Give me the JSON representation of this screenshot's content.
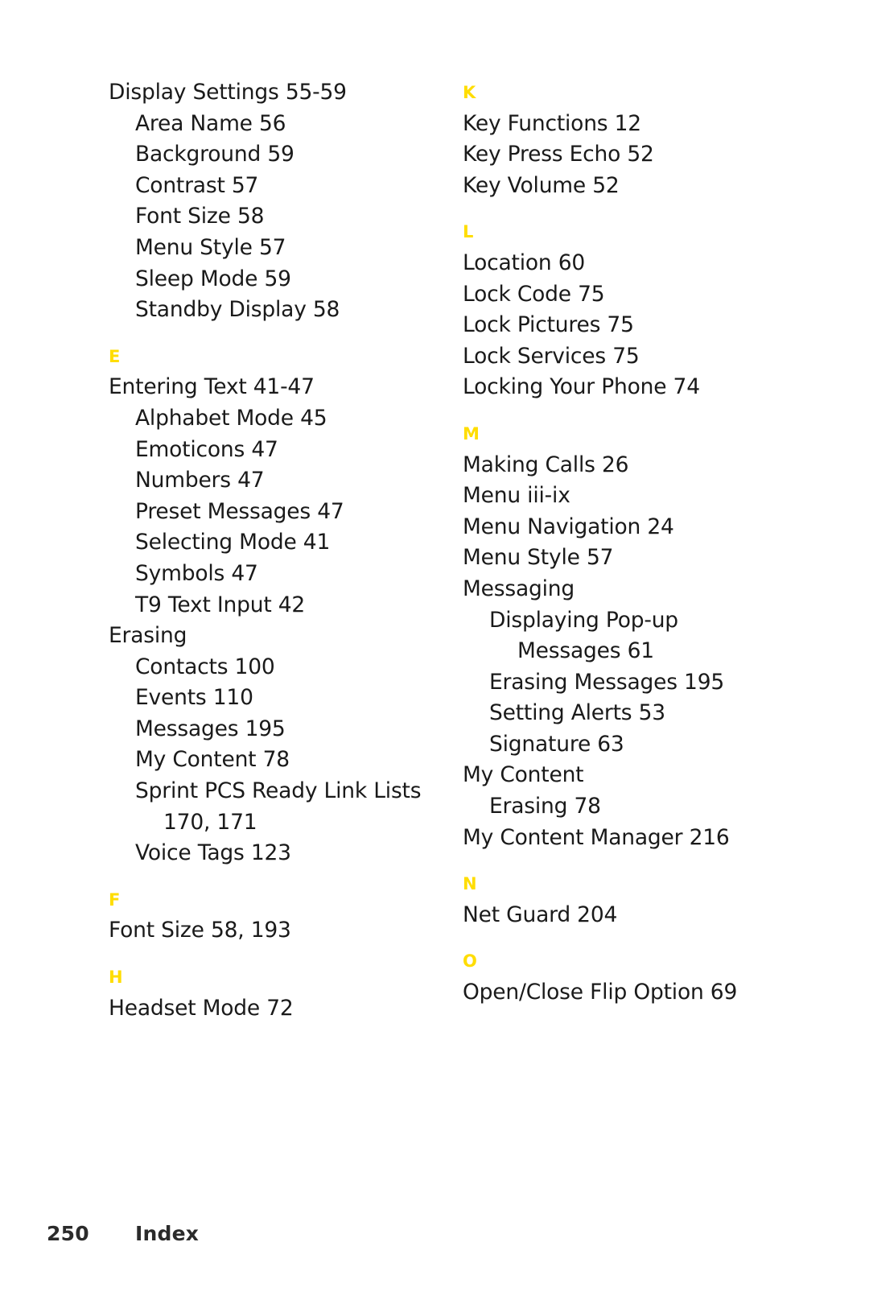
{
  "document": {
    "type": "index-page",
    "page_number": "250",
    "running_head": "Index",
    "accent_color": "#FFDD00",
    "text_color": "#1a1a1a",
    "background_color": "#ffffff"
  },
  "footer": {
    "page_number": "250",
    "label": "Index"
  },
  "columns": [
    {
      "id": "left",
      "blocks": [
        {
          "kind": "entries",
          "lines": [
            {
              "level": 0,
              "text": "Display Settings 55-59"
            },
            {
              "level": 1,
              "text": "Area Name 56"
            },
            {
              "level": 1,
              "text": "Background 59"
            },
            {
              "level": 1,
              "text": "Contrast 57"
            },
            {
              "level": 1,
              "text": "Font Size 58"
            },
            {
              "level": 1,
              "text": "Menu Style 57"
            },
            {
              "level": 1,
              "text": "Sleep Mode 59"
            },
            {
              "level": 1,
              "text": "Standby Display 58"
            }
          ]
        },
        {
          "kind": "section",
          "letter": "E",
          "lines": [
            {
              "level": 0,
              "text": "Entering Text 41-47"
            },
            {
              "level": 1,
              "text": "Alphabet Mode 45"
            },
            {
              "level": 1,
              "text": "Emoticons 47"
            },
            {
              "level": 1,
              "text": "Numbers 47"
            },
            {
              "level": 1,
              "text": "Preset Messages 47"
            },
            {
              "level": 1,
              "text": "Selecting Mode 41"
            },
            {
              "level": 1,
              "text": "Symbols 47"
            },
            {
              "level": 1,
              "text": "T9 Text Input 42"
            },
            {
              "level": 0,
              "text": "Erasing"
            },
            {
              "level": 1,
              "text": "Contacts 100"
            },
            {
              "level": 1,
              "text": "Events 110"
            },
            {
              "level": 1,
              "text": "Messages 195"
            },
            {
              "level": 1,
              "text": "My Content 78"
            },
            {
              "level": 1,
              "text": "Sprint PCS Ready Link Lists"
            },
            {
              "level": 1,
              "cont": 1,
              "text": "170, 171"
            },
            {
              "level": 1,
              "text": "Voice Tags 123"
            }
          ]
        },
        {
          "kind": "section",
          "letter": "F",
          "lines": [
            {
              "level": 0,
              "text": "Font Size 58, 193"
            }
          ]
        },
        {
          "kind": "section",
          "letter": "H",
          "lines": [
            {
              "level": 0,
              "text": "Headset Mode 72"
            }
          ]
        }
      ]
    },
    {
      "id": "right",
      "blocks": [
        {
          "kind": "section",
          "letter": "K",
          "first": true,
          "lines": [
            {
              "level": 0,
              "text": "Key Functions 12"
            },
            {
              "level": 0,
              "text": "Key Press Echo 52"
            },
            {
              "level": 0,
              "text": "Key Volume 52"
            }
          ]
        },
        {
          "kind": "section",
          "letter": "L",
          "lines": [
            {
              "level": 0,
              "text": "Location 60"
            },
            {
              "level": 0,
              "text": "Lock Code 75"
            },
            {
              "level": 0,
              "text": "Lock Pictures 75"
            },
            {
              "level": 0,
              "text": "Lock Services 75"
            },
            {
              "level": 0,
              "text": "Locking Your Phone 74"
            }
          ]
        },
        {
          "kind": "section",
          "letter": "M",
          "lines": [
            {
              "level": 0,
              "text": "Making Calls 26"
            },
            {
              "level": 0,
              "text": "Menu iii-ix"
            },
            {
              "level": 0,
              "text": "Menu Navigation 24"
            },
            {
              "level": 0,
              "text": "Menu Style 57"
            },
            {
              "level": 0,
              "text": "Messaging"
            },
            {
              "level": 1,
              "text": "Displaying Pop-up"
            },
            {
              "level": 1,
              "cont": 1,
              "text": "Messages 61"
            },
            {
              "level": 1,
              "text": "Erasing Messages 195"
            },
            {
              "level": 1,
              "text": "Setting Alerts 53"
            },
            {
              "level": 1,
              "text": "Signature 63"
            },
            {
              "level": 0,
              "text": "My Content"
            },
            {
              "level": 1,
              "text": "Erasing 78"
            },
            {
              "level": 0,
              "text": "My Content Manager 216"
            }
          ]
        },
        {
          "kind": "section",
          "letter": "N",
          "lines": [
            {
              "level": 0,
              "text": "Net Guard 204"
            }
          ]
        },
        {
          "kind": "section",
          "letter": "O",
          "lines": [
            {
              "level": 0,
              "text": "Open/Close Flip Option 69"
            }
          ]
        }
      ]
    }
  ]
}
